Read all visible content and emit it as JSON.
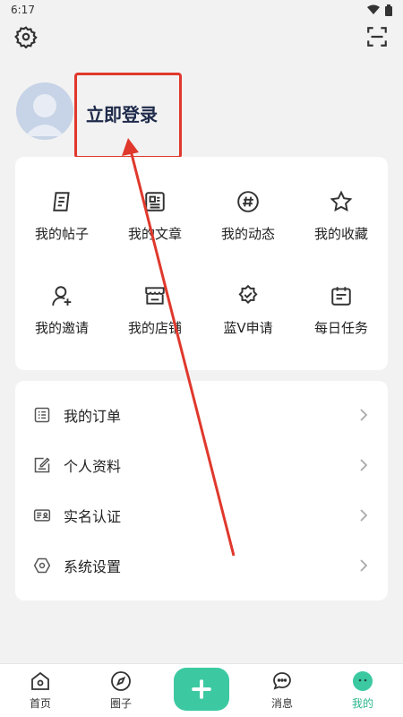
{
  "status_bar": {
    "time": "6:17"
  },
  "profile": {
    "login_label": "立即登录"
  },
  "grid": [
    {
      "label": "我的帖子",
      "icon": "post-icon"
    },
    {
      "label": "我的文章",
      "icon": "article-icon"
    },
    {
      "label": "我的动态",
      "icon": "hashtag-icon"
    },
    {
      "label": "我的收藏",
      "icon": "star-icon"
    },
    {
      "label": "我的邀请",
      "icon": "invite-user-icon"
    },
    {
      "label": "我的店铺",
      "icon": "store-icon"
    },
    {
      "label": "蓝V申请",
      "icon": "verified-badge-icon"
    },
    {
      "label": "每日任务",
      "icon": "calendar-icon"
    }
  ],
  "list": [
    {
      "label": "我的订单",
      "icon": "order-list-icon"
    },
    {
      "label": "个人资料",
      "icon": "edit-profile-icon"
    },
    {
      "label": "实名认证",
      "icon": "id-card-icon"
    },
    {
      "label": "系统设置",
      "icon": "hexagon-settings-icon"
    }
  ],
  "tabs": [
    {
      "label": "首页",
      "icon": "home-icon"
    },
    {
      "label": "圈子",
      "icon": "compass-icon"
    },
    {
      "label": "",
      "icon": "plus-icon"
    },
    {
      "label": "消息",
      "icon": "message-icon"
    },
    {
      "label": "我的",
      "icon": "profile-face-icon"
    }
  ],
  "colors": {
    "accent": "#3cc9a2",
    "active_tab": "#2bb58c",
    "annotation": "#e0382c"
  }
}
